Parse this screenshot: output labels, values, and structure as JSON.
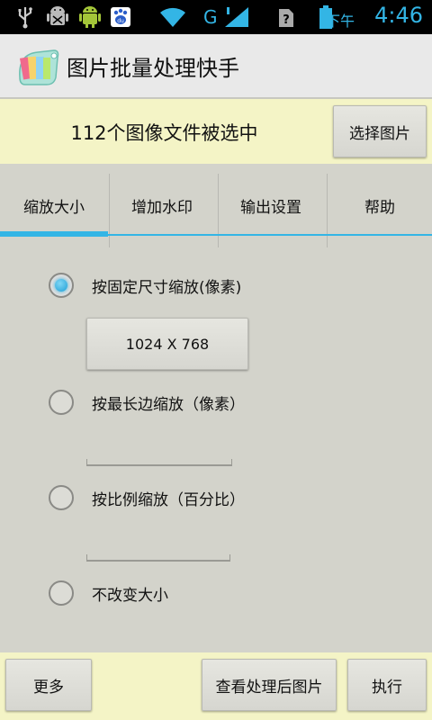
{
  "status_bar": {
    "network": "G",
    "ampm": "下午",
    "time": "4:46",
    "accent_color": "#33b5e5",
    "icons": [
      "usb-icon",
      "android-debug-icon",
      "android-icon",
      "baidu-icon",
      "wifi-icon",
      "signal-icon",
      "sim-unknown-icon",
      "battery-icon"
    ]
  },
  "title_bar": {
    "title": "图片批量处理快手"
  },
  "selection": {
    "count_text": "112个图像文件被选中",
    "select_button": "选择图片"
  },
  "tabs": [
    {
      "label": "缩放大小",
      "active": true
    },
    {
      "label": "增加水印",
      "active": false
    },
    {
      "label": "输出设置",
      "active": false
    },
    {
      "label": "帮助",
      "active": false
    }
  ],
  "options": {
    "fixed_size": {
      "label": "按固定尺寸缩放(像素)",
      "checked": true,
      "value": "1024 X 768"
    },
    "longest_side": {
      "label": "按最长边缩放（像素）",
      "checked": false,
      "value": ""
    },
    "percentage": {
      "label": "按比例缩放（百分比）",
      "checked": false,
      "value": ""
    },
    "no_change": {
      "label": "不改变大小",
      "checked": false
    }
  },
  "bottom_bar": {
    "more": "更多",
    "view_processed": "查看处理后图片",
    "execute": "执行"
  }
}
